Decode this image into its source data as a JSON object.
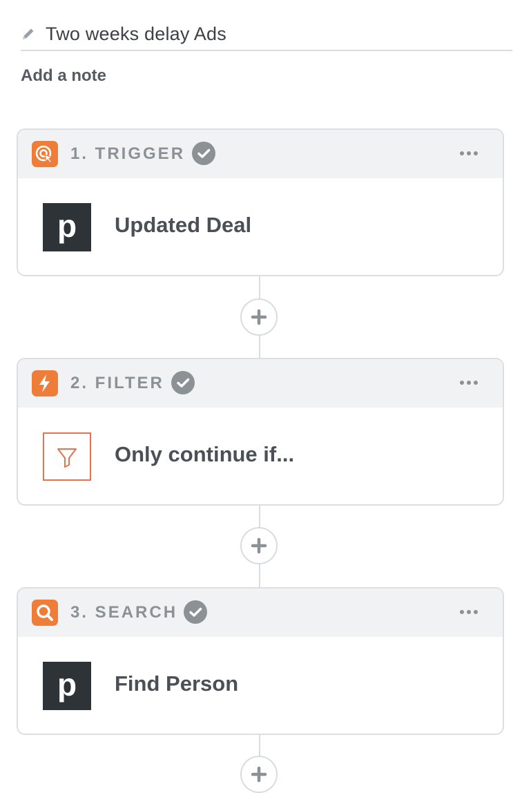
{
  "zap": {
    "title": "Two weeks delay Ads",
    "add_note_label": "Add a note"
  },
  "steps": [
    {
      "label": "1. TRIGGER",
      "badge_icon": "trigger-cursor-icon",
      "status_icon": "check-circle-icon",
      "menu_icon": "more-horizontal-icon",
      "app_icon": "pipedrive-logo",
      "app_logo_text": "p",
      "title": "Updated Deal"
    },
    {
      "label": "2. FILTER",
      "badge_icon": "lightning-bolt-icon",
      "status_icon": "check-circle-icon",
      "menu_icon": "more-horizontal-icon",
      "app_icon": "filter-funnel-icon",
      "title": "Only continue if..."
    },
    {
      "label": "3. SEARCH",
      "badge_icon": "magnifier-icon",
      "status_icon": "check-circle-icon",
      "menu_icon": "more-horizontal-icon",
      "app_icon": "pipedrive-logo",
      "app_logo_text": "p",
      "title": "Find Person"
    }
  ],
  "add_step_icon": "plus-icon",
  "colors": {
    "badge": "#ee7d3a",
    "filter_accent": "#e8704a",
    "pipedrive_bg": "#2e3337",
    "header_bg": "#f0f2f3",
    "check_bg": "#8c9196"
  }
}
